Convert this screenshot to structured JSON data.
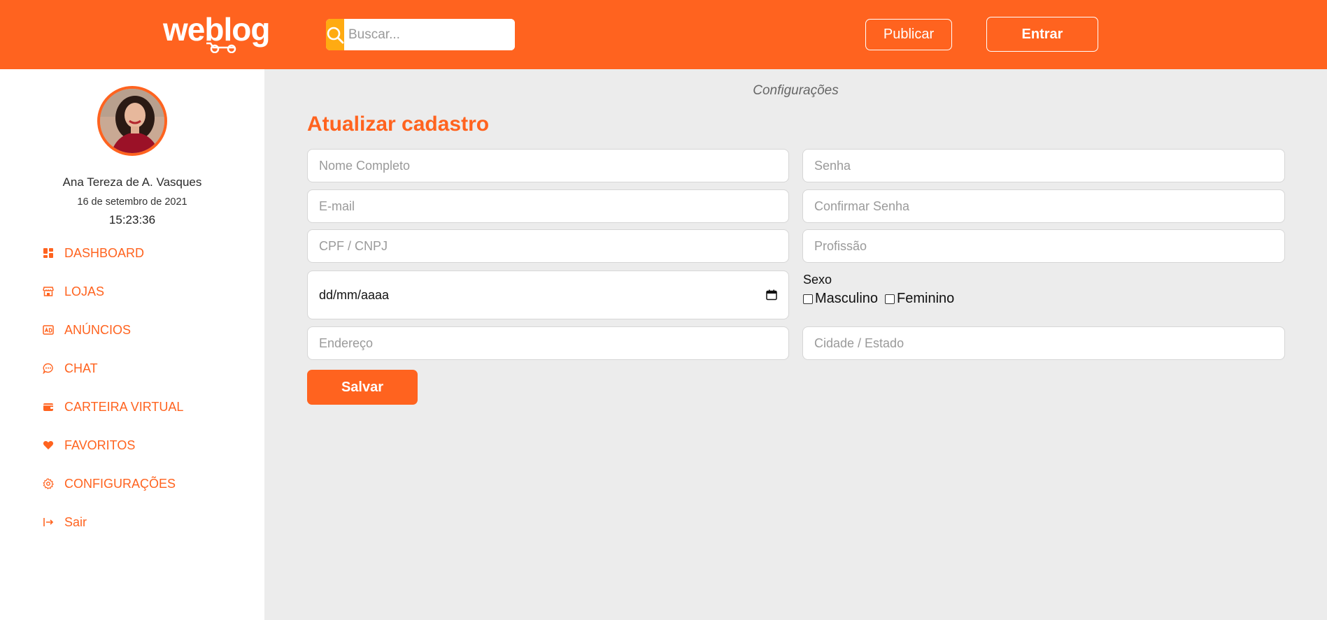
{
  "header": {
    "logo_text": "weblog",
    "search_placeholder": "Buscar...",
    "publish_label": "Publicar",
    "login_label": "Entrar"
  },
  "sidebar": {
    "user_name": "Ana Tereza de A. Vasques",
    "date": "16 de setembro de 2021",
    "time": "15:23:36",
    "items": [
      {
        "label": "DASHBOARD",
        "icon": "dashboard-icon"
      },
      {
        "label": "LOJAS",
        "icon": "store-icon"
      },
      {
        "label": "ANÚNCIOS",
        "icon": "ad-icon"
      },
      {
        "label": "CHAT",
        "icon": "chat-icon"
      },
      {
        "label": "CARTEIRA VIRTUAL",
        "icon": "wallet-icon"
      },
      {
        "label": "FAVORITOS",
        "icon": "heart-icon"
      },
      {
        "label": "CONFIGURAÇÕES",
        "icon": "gear-icon"
      },
      {
        "label": "Sair",
        "icon": "logout-icon"
      }
    ]
  },
  "main": {
    "breadcrumb": "Configurações",
    "title": "Atualizar cadastro",
    "form": {
      "nome_placeholder": "Nome Completo",
      "senha_placeholder": "Senha",
      "email_placeholder": "E-mail",
      "confirmar_senha_placeholder": "Confirmar Senha",
      "cpf_placeholder": "CPF / CNPJ",
      "profissao_placeholder": "Profissão",
      "date_placeholder": "dd/mm/aaaa",
      "sexo_label": "Sexo",
      "sexo_options": [
        "Masculino",
        "Feminino"
      ],
      "endereco_placeholder": "Endereço",
      "cidade_placeholder": "Cidade / Estado",
      "save_label": "Salvar"
    }
  },
  "colors": {
    "brand": "#ff631f",
    "search_button": "#ffab12",
    "background": "#ececec"
  }
}
